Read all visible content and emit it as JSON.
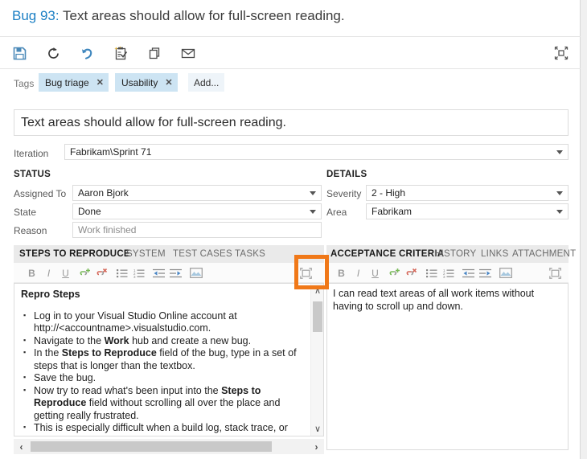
{
  "header": {
    "work_item_id": "Bug 93:",
    "work_item_title": "Text areas should allow for full-screen reading."
  },
  "toolbar": {
    "buttons": [
      {
        "name": "save-icon",
        "tooltip": "Save"
      },
      {
        "name": "refresh-icon",
        "tooltip": "Refresh"
      },
      {
        "name": "undo-icon",
        "tooltip": "Revert"
      },
      {
        "name": "new-linked-work-item-icon",
        "tooltip": "New linked work item"
      },
      {
        "name": "copy-icon",
        "tooltip": "Copy work item"
      },
      {
        "name": "email-icon",
        "tooltip": "Send email"
      }
    ],
    "collapse_icon": "collapse-inward-icon"
  },
  "tags": {
    "label": "Tags",
    "items": [
      "Bug triage",
      "Usability"
    ],
    "remove_glyph": "✕",
    "add_label": "Add..."
  },
  "title_field": {
    "value": "Text areas should allow for full-screen reading."
  },
  "iteration": {
    "label": "Iteration",
    "value": "Fabrikam\\Sprint 71"
  },
  "status": {
    "heading": "STATUS",
    "fields": [
      {
        "label": "Assigned To",
        "value": "Aaron Bjork",
        "dropdown": true,
        "readonly": false
      },
      {
        "label": "State",
        "value": "Done",
        "dropdown": true,
        "readonly": false
      },
      {
        "label": "Reason",
        "value": "Work finished",
        "dropdown": false,
        "readonly": true
      }
    ]
  },
  "details": {
    "heading": "DETAILS",
    "fields": [
      {
        "label": "Severity",
        "value": "2 - High",
        "dropdown": true,
        "readonly": false
      },
      {
        "label": "Area",
        "value": "Fabrikam",
        "dropdown": true,
        "readonly": false
      }
    ]
  },
  "left_panel": {
    "tabs": [
      {
        "label": "STEPS TO REPRODUCE",
        "active": true
      },
      {
        "label": "SYSTEM",
        "active": false
      },
      {
        "label": "TEST CASES",
        "active": false
      },
      {
        "label": "TASKS",
        "active": false
      }
    ],
    "editor_tools": [
      {
        "name": "bold-icon",
        "glyph": "B"
      },
      {
        "name": "italic-icon",
        "glyph": "I"
      },
      {
        "name": "underline-icon",
        "glyph": "U"
      },
      {
        "name": "insert-link-icon",
        "glyph": ""
      },
      {
        "name": "remove-link-icon",
        "glyph": ""
      },
      {
        "name": "bulleted-list-icon",
        "glyph": ""
      },
      {
        "name": "numbered-list-icon",
        "glyph": ""
      },
      {
        "name": "decrease-indent-icon",
        "glyph": ""
      },
      {
        "name": "increase-indent-icon",
        "glyph": ""
      },
      {
        "name": "insert-image-icon",
        "glyph": ""
      }
    ],
    "maximize_icon": "maximize-editor-icon",
    "content_heading": "Repro Steps",
    "content_items": [
      "Log in to your Visual Studio Online account at http://&lt;accountname&gt;.visualstudio.com.",
      "Navigate to the <b>Work</b> hub and create a new bug.",
      "In the <b>Steps to Reproduce</b> field of the bug, type in a set of steps that is longer than the textbox.",
      "Save the bug.",
      "Now try to read what's been input into the <b>Steps to Reproduce</b> field without scrolling all over the place and getting really frustrated.",
      "This is especially difficult when a build log, stack trace, or file list"
    ],
    "scroll_up_glyph": "∧",
    "scroll_down_glyph": "∨",
    "scroll_left_glyph": "‹",
    "scroll_right_glyph": "›"
  },
  "right_panel": {
    "tabs": [
      {
        "label": "ACCEPTANCE CRITERIA",
        "active": true
      },
      {
        "label": "HISTORY",
        "active": false
      },
      {
        "label": "LINKS",
        "active": false
      },
      {
        "label": "ATTACHMENT",
        "active": false
      }
    ],
    "maximize_icon": "maximize-editor-icon",
    "content_text": "I can read text areas of all work items without having to scroll up and down."
  },
  "annotation": {
    "highlight_color": "#f07818",
    "target": "maximize-editor-icon"
  },
  "colors": {
    "link": "#1b7fc4",
    "tag_bg": "#cde4f3",
    "tab_strip_bg": "#eaeaea",
    "highlight": "#f07818"
  }
}
